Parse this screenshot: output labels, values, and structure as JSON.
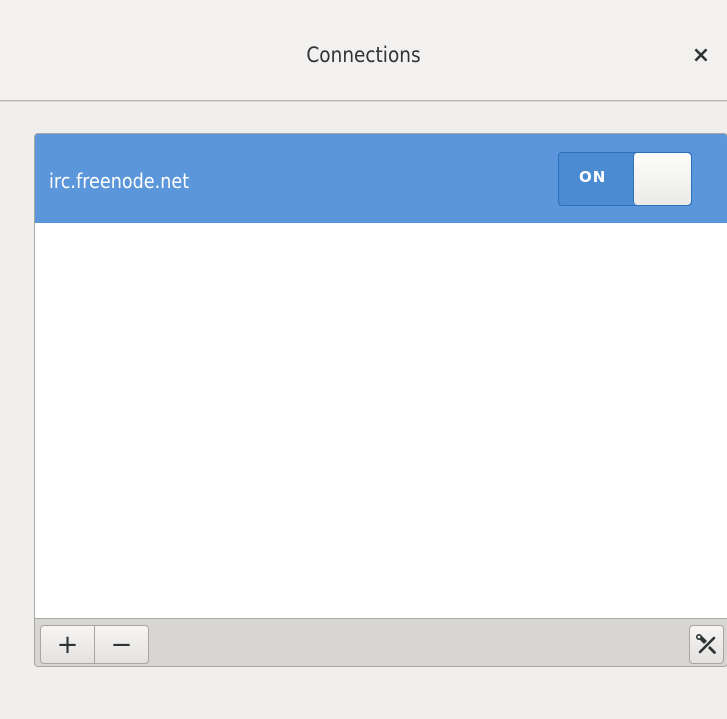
{
  "window": {
    "title": "Connections",
    "close_label": "×"
  },
  "connections": [
    {
      "name": "irc.freenode.net",
      "enabled": true,
      "switch_label": "ON"
    }
  ],
  "toolbar": {
    "add_label": "+",
    "remove_label": "−"
  },
  "colors": {
    "selection": "#5a96d9",
    "switch_on": "#4a8bd1",
    "background": "#f0efee"
  },
  "icons": {
    "close": "close-icon",
    "add": "plus-icon",
    "remove": "minus-icon",
    "properties": "tools-icon"
  }
}
